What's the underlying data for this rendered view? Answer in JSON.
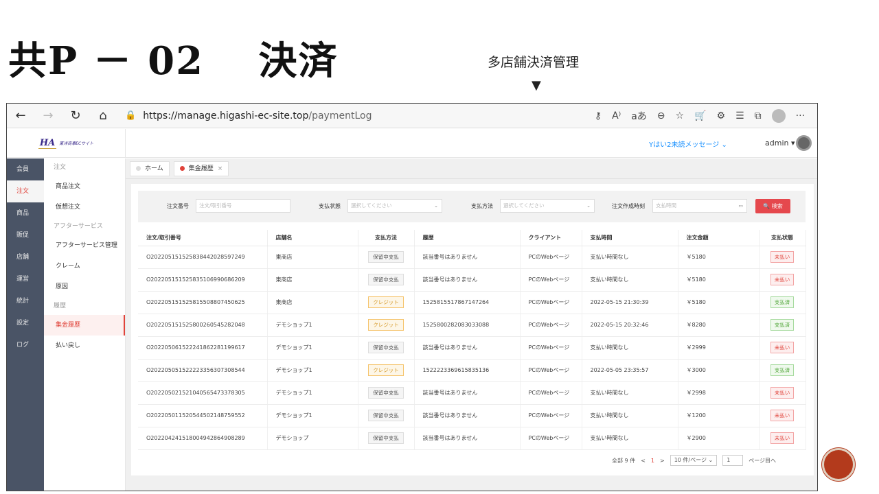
{
  "slide": {
    "title": "共P － 02　 決済",
    "subtitle": "多店舗決済管理",
    "arrow": "▼"
  },
  "browser": {
    "back": "←",
    "forward": "→",
    "reload": "↻",
    "home": "⌂",
    "lock": "🔒",
    "url_host": "https://manage.higashi-ec-site.top",
    "url_path": "/paymentLog",
    "icons": [
      "key-icon",
      "read-aloud-icon",
      "font-icon",
      "zoom-out-icon",
      "favorite-add-icon",
      "cart-icon",
      "extensions-icon",
      "favorites-icon",
      "collections-icon",
      "profile-icon",
      "more-icon"
    ],
    "icon_glyphs": {
      "key": "⚷",
      "read": "A⁾",
      "font": "aあ",
      "zoom": "⊖",
      "fav": "☆",
      "cart": "🛒",
      "ext": "⚙",
      "favs": "☰",
      "coll": "⧉",
      "more": "···"
    }
  },
  "header": {
    "logo": "HA",
    "logo_text": "東洋商事ECサイト",
    "messages": "Yはい2未読メッセージ ⌄",
    "user": "admin ▾"
  },
  "sidebar_main": [
    "会員",
    "注文",
    "商品",
    "販促",
    "店舗",
    "運営",
    "統計",
    "設定",
    "ログ"
  ],
  "sidebar_active": "注文",
  "sidebar_sub": [
    {
      "type": "group",
      "label": "注文"
    },
    {
      "type": "item",
      "label": "商品注文"
    },
    {
      "type": "item",
      "label": "仮想注文"
    },
    {
      "type": "group",
      "label": "アフターサービス"
    },
    {
      "type": "item",
      "label": "アフターサービス管理"
    },
    {
      "type": "item",
      "label": "クレーム"
    },
    {
      "type": "item",
      "label": "原因"
    },
    {
      "type": "group",
      "label": "履歴"
    },
    {
      "type": "item",
      "label": "集金履歴",
      "active": true
    },
    {
      "type": "item",
      "label": "払い戻し"
    }
  ],
  "tabs": [
    {
      "label": "ホーム"
    },
    {
      "label": "集金履歴",
      "active": true,
      "close": "×"
    }
  ],
  "filter": {
    "order_no_label": "注文番号",
    "order_no_placeholder": "注文/取引番号",
    "pay_status_label": "支払状態",
    "pay_status_placeholder": "選択してください",
    "pay_method_label": "支払方法",
    "pay_method_placeholder": "選択してください",
    "created_label": "注文作成時刻",
    "created_placeholder": "支払時間",
    "search_button": "検索",
    "caret": "⌄",
    "calendar": "▭"
  },
  "table": {
    "columns": [
      "注文/取引番号",
      "店舗名",
      "支払方法",
      "履歴",
      "クライアント",
      "支払時間",
      "注文金額",
      "支払状態"
    ],
    "rows": [
      [
        "O202205151525838442028597249",
        "東商店",
        "保留中支払",
        "該当番号はありません",
        "PCのWebページ",
        "支払い時間なし",
        "￥5180",
        "未払い"
      ],
      [
        "O202205151525835106990686209",
        "東商店",
        "保留中支払",
        "該当番号はありません",
        "PCのWebページ",
        "支払い時間なし",
        "￥5180",
        "未払い"
      ],
      [
        "O202205151525815508807450625",
        "東商店",
        "クレジット",
        "1525815517867147264",
        "PCのWebページ",
        "2022-05-15 21:30:39",
        "￥5180",
        "支払済"
      ],
      [
        "O202205151525800260545282048",
        "デモショップ1",
        "クレジット",
        "1525800282083033088",
        "PCのWebページ",
        "2022-05-15 20:32:46",
        "￥8280",
        "支払済"
      ],
      [
        "O202205061522241862281199617",
        "デモショップ1",
        "保留中支払",
        "該当番号はありません",
        "PCのWebページ",
        "支払い時間なし",
        "￥2999",
        "未払い"
      ],
      [
        "O202205051522223356307308544",
        "デモショップ1",
        "クレジット",
        "1522223369615835136",
        "PCのWebページ",
        "2022-05-05 23:35:57",
        "￥3000",
        "支払済"
      ],
      [
        "O202205021521040565473378305",
        "デモショップ1",
        "保留中支払",
        "該当番号はありません",
        "PCのWebページ",
        "支払い時間なし",
        "￥2998",
        "未払い"
      ],
      [
        "O202205011520544502148759552",
        "デモショップ1",
        "保留中支払",
        "該当番号はありません",
        "PCのWebページ",
        "支払い時間なし",
        "￥1200",
        "未払い"
      ],
      [
        "O202204241518004942864908289",
        "デモショップ",
        "保留中支払",
        "該当番号はありません",
        "PCのWebページ",
        "支払い時間なし",
        "￥2900",
        "未払い"
      ]
    ]
  },
  "pagination": {
    "total": "全部 9 件",
    "prev": "<",
    "current": "1",
    "next": ">",
    "page_size": "10 件/ページ ⌄",
    "goto_value": "1",
    "goto_label": "ページ目へ"
  }
}
